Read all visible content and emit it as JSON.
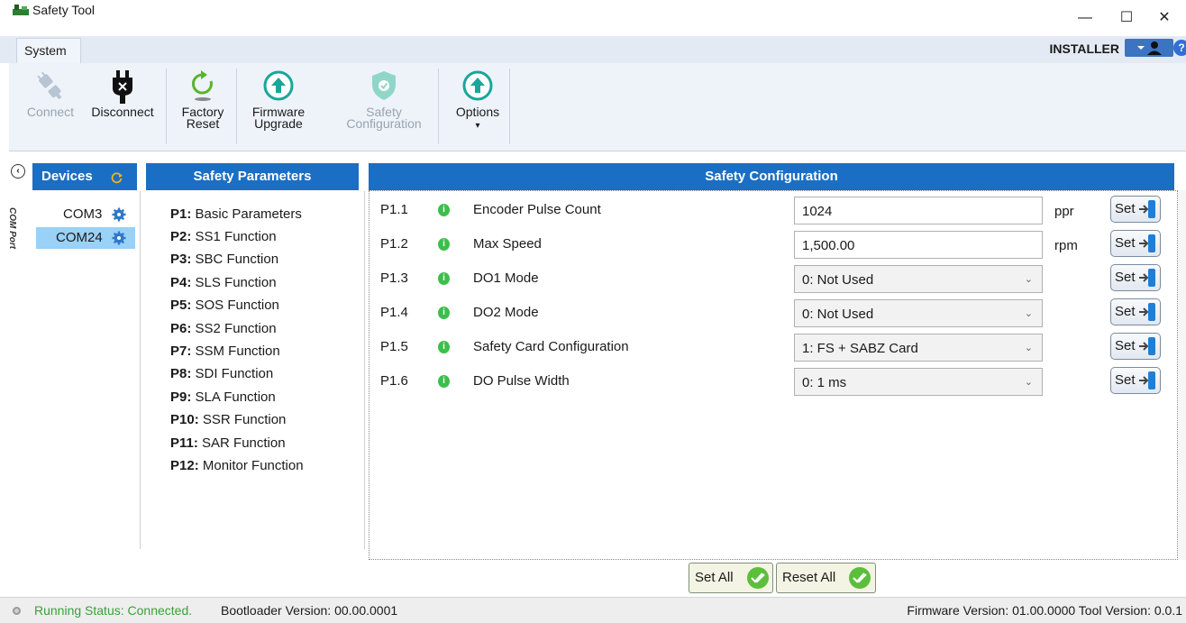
{
  "window": {
    "title": "Safety Tool",
    "minimize_glyph": "—",
    "maximize_glyph": "☐",
    "close_glyph": "✕"
  },
  "tabs": {
    "system": "System"
  },
  "user": {
    "role": "INSTALLER",
    "help_glyph": "?"
  },
  "ribbon": {
    "connect": "Connect",
    "disconnect": "Disconnect",
    "factory_reset_1": "Factory",
    "factory_reset_2": "Reset",
    "firmware_upgrade_1": "Firmware",
    "firmware_upgrade_2": "Upgrade",
    "safety_config_1": "Safety",
    "safety_config_2": "Configuration",
    "options": "Options",
    "options_arrow": "▾"
  },
  "devices": {
    "header": "Devices",
    "vertical_label": "COM Port",
    "items": [
      {
        "label": "COM3",
        "selected": false
      },
      {
        "label": "COM24",
        "selected": true
      }
    ]
  },
  "params": {
    "header": "Safety Parameters",
    "items": [
      {
        "code": "P1:",
        "name": " Basic Parameters"
      },
      {
        "code": "P2:",
        "name": " SS1 Function"
      },
      {
        "code": "P3:",
        "name": " SBC Function"
      },
      {
        "code": "P4:",
        "name": " SLS Function"
      },
      {
        "code": "P5:",
        "name": " SOS Function"
      },
      {
        "code": "P6:",
        "name": " SS2 Function"
      },
      {
        "code": "P7:",
        "name": " SSM Function"
      },
      {
        "code": "P8:",
        "name": " SDI Function"
      },
      {
        "code": "P9:",
        "name": " SLA Function"
      },
      {
        "code": "P10:",
        "name": " SSR Function"
      },
      {
        "code": "P11:",
        "name": " SAR Function"
      },
      {
        "code": "P12:",
        "name": " Monitor Function"
      }
    ]
  },
  "config": {
    "header": "Safety Configuration",
    "info_glyph": "i",
    "set_label": "Set",
    "dropdown_glyph": "⌄",
    "rows": [
      {
        "id": "P1.1",
        "name": "Encoder Pulse Count",
        "value": "1024",
        "unit": "ppr"
      },
      {
        "id": "P1.2",
        "name": "Max Speed",
        "value": "1,500.00",
        "unit": "rpm"
      },
      {
        "id": "P1.3",
        "name": "DO1 Mode",
        "value": "0: Not Used",
        "unit": ""
      },
      {
        "id": "P1.4",
        "name": "DO2 Mode",
        "value": "0: Not Used",
        "unit": ""
      },
      {
        "id": "P1.5",
        "name": "Safety Card Configuration",
        "value": "1: FS + SABZ Card",
        "unit": ""
      },
      {
        "id": "P1.6",
        "name": "DO Pulse Width",
        "value": "0: 1 ms",
        "unit": ""
      }
    ]
  },
  "actions": {
    "set_all": "Set All",
    "reset_all": "Reset All"
  },
  "status": {
    "running": "Running Status: Connected.",
    "bootloader": "Bootloader Version: 00.00.0001",
    "versions": "Firmware Version: 01.00.0000 Tool Version: 0.0.1"
  },
  "colors": {
    "header_blue": "#1a6fc4",
    "selected_bg": "#99d1f7",
    "status_green": "#3aa03a",
    "check_green": "#5bbf3c",
    "teal_icon": "#1aa69a"
  }
}
